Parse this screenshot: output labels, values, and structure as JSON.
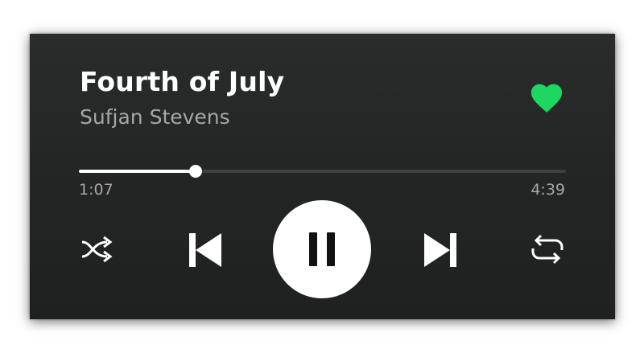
{
  "track": {
    "title": "Fourth of July",
    "artist": "Sufjan Stevens",
    "liked": true
  },
  "playback": {
    "elapsed": "1:07",
    "total": "4:39",
    "progress_fraction": 0.24,
    "state": "playing"
  },
  "controls": {
    "shuffle_icon": "shuffle-icon",
    "previous_icon": "skip-previous-icon",
    "play_pause_icon": "pause-icon",
    "next_icon": "skip-next-icon",
    "repeat_icon": "repeat-icon"
  },
  "colors": {
    "accent": "#1ed760",
    "background": "#232424",
    "text_primary": "#ffffff",
    "text_secondary": "#a7a7a7"
  }
}
